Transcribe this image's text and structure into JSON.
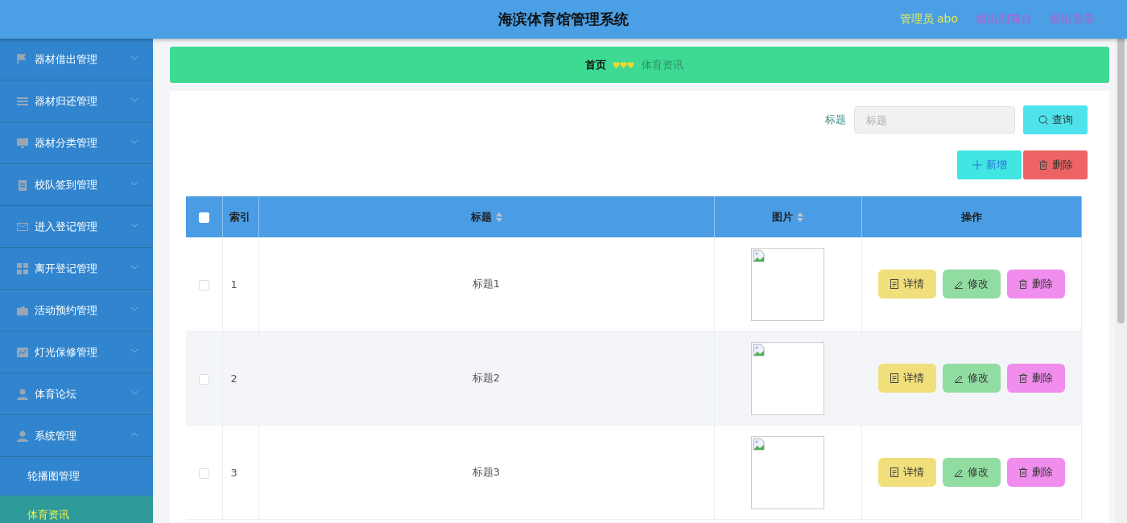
{
  "header": {
    "title": "海滨体育馆管理系统",
    "user": "管理员 abo",
    "links": [
      "退出到前台",
      "退出登录"
    ]
  },
  "sidebar": {
    "items": [
      {
        "label": "器材借出管理",
        "expanded": false
      },
      {
        "label": "器材归还管理",
        "expanded": false
      },
      {
        "label": "器材分类管理",
        "expanded": false
      },
      {
        "label": "校队签到管理",
        "expanded": false
      },
      {
        "label": "进入登记管理",
        "expanded": false
      },
      {
        "label": "离开登记管理",
        "expanded": false
      },
      {
        "label": "活动预约管理",
        "expanded": false
      },
      {
        "label": "灯光保修管理",
        "expanded": false
      },
      {
        "label": "体育论坛",
        "expanded": false
      },
      {
        "label": "系统管理",
        "expanded": true,
        "children": [
          {
            "label": "轮播图管理",
            "selected": false
          },
          {
            "label": "体育资讯",
            "selected": true
          }
        ]
      }
    ]
  },
  "breadcrumb": {
    "home": "首页",
    "current": "体育资讯"
  },
  "search": {
    "label": "标题",
    "placeholder": "标题",
    "button": "查询"
  },
  "toolbar": [
    {
      "kind": "add",
      "label": "新增"
    },
    {
      "kind": "delete",
      "label": "删除"
    }
  ],
  "table": {
    "all_checked": false,
    "columns": [
      {
        "label": "索引",
        "sortable": false
      },
      {
        "label": "标题",
        "sortable": true
      },
      {
        "label": "图片",
        "sortable": true
      },
      {
        "label": "操作",
        "sortable": false
      }
    ],
    "rows": [
      {
        "checked": false,
        "index": "1",
        "title": "标题1",
        "actions": [
          {
            "kind": "detail",
            "label": "详情"
          },
          {
            "kind": "edit",
            "label": "修改"
          },
          {
            "kind": "delete",
            "label": "删除"
          }
        ]
      },
      {
        "checked": false,
        "index": "2",
        "title": "标题2",
        "actions": [
          {
            "kind": "detail",
            "label": "详情"
          },
          {
            "kind": "edit",
            "label": "修改"
          },
          {
            "kind": "delete",
            "label": "删除"
          }
        ]
      },
      {
        "checked": false,
        "index": "3",
        "title": "标题3",
        "actions": [
          {
            "kind": "detail",
            "label": "详情"
          },
          {
            "kind": "edit",
            "label": "修改"
          },
          {
            "kind": "delete",
            "label": "删除"
          }
        ]
      }
    ]
  }
}
